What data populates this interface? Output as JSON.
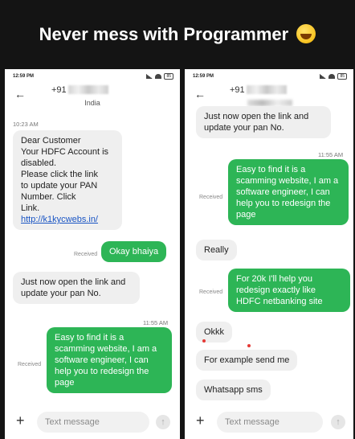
{
  "meme": {
    "title": "Never mess with Programmer",
    "emoji": "laughing-tears-emoji"
  },
  "status": {
    "time": "12:59 PM",
    "battery": "85"
  },
  "compose": {
    "placeholder": "Text message"
  },
  "left": {
    "contact": "+91",
    "country": "India",
    "messages": [
      {
        "type": "time",
        "text": "10:23 AM"
      },
      {
        "type": "in",
        "lines": [
          "Dear Customer",
          "Your HDFC Account is",
          "disabled.",
          "Please click the link",
          "to update your PAN",
          "Number. Click",
          "Link."
        ],
        "link": "http://k1kycwebs.in/"
      },
      {
        "type": "out",
        "status": "Received",
        "text": "Okay bhaiya"
      },
      {
        "type": "in",
        "text": "Just now open the link and update your pan No."
      },
      {
        "type": "time",
        "text": "11:55 AM"
      },
      {
        "type": "out",
        "status": "Received",
        "text": "Easy to find it is a scamming website, I am a software engineer, I can help you to redesign the page"
      }
    ]
  },
  "right": {
    "contact": "+91",
    "messages": [
      {
        "type": "in",
        "text": "Just now open the link and update your pan No."
      },
      {
        "type": "time",
        "text": "11:55 AM"
      },
      {
        "type": "out",
        "status": "Received",
        "text": "Easy to find it is a scamming website, I am a software engineer, I can help you to redesign the page"
      },
      {
        "type": "in",
        "text": "Really"
      },
      {
        "type": "out",
        "status": "Received",
        "text": "For 20k I'll help you redesign exactly like HDFC netbanking site"
      },
      {
        "type": "in",
        "text": "Okkk"
      },
      {
        "type": "in",
        "text": "For example send me"
      },
      {
        "type": "in",
        "text": "Whatsapp sms"
      }
    ]
  }
}
